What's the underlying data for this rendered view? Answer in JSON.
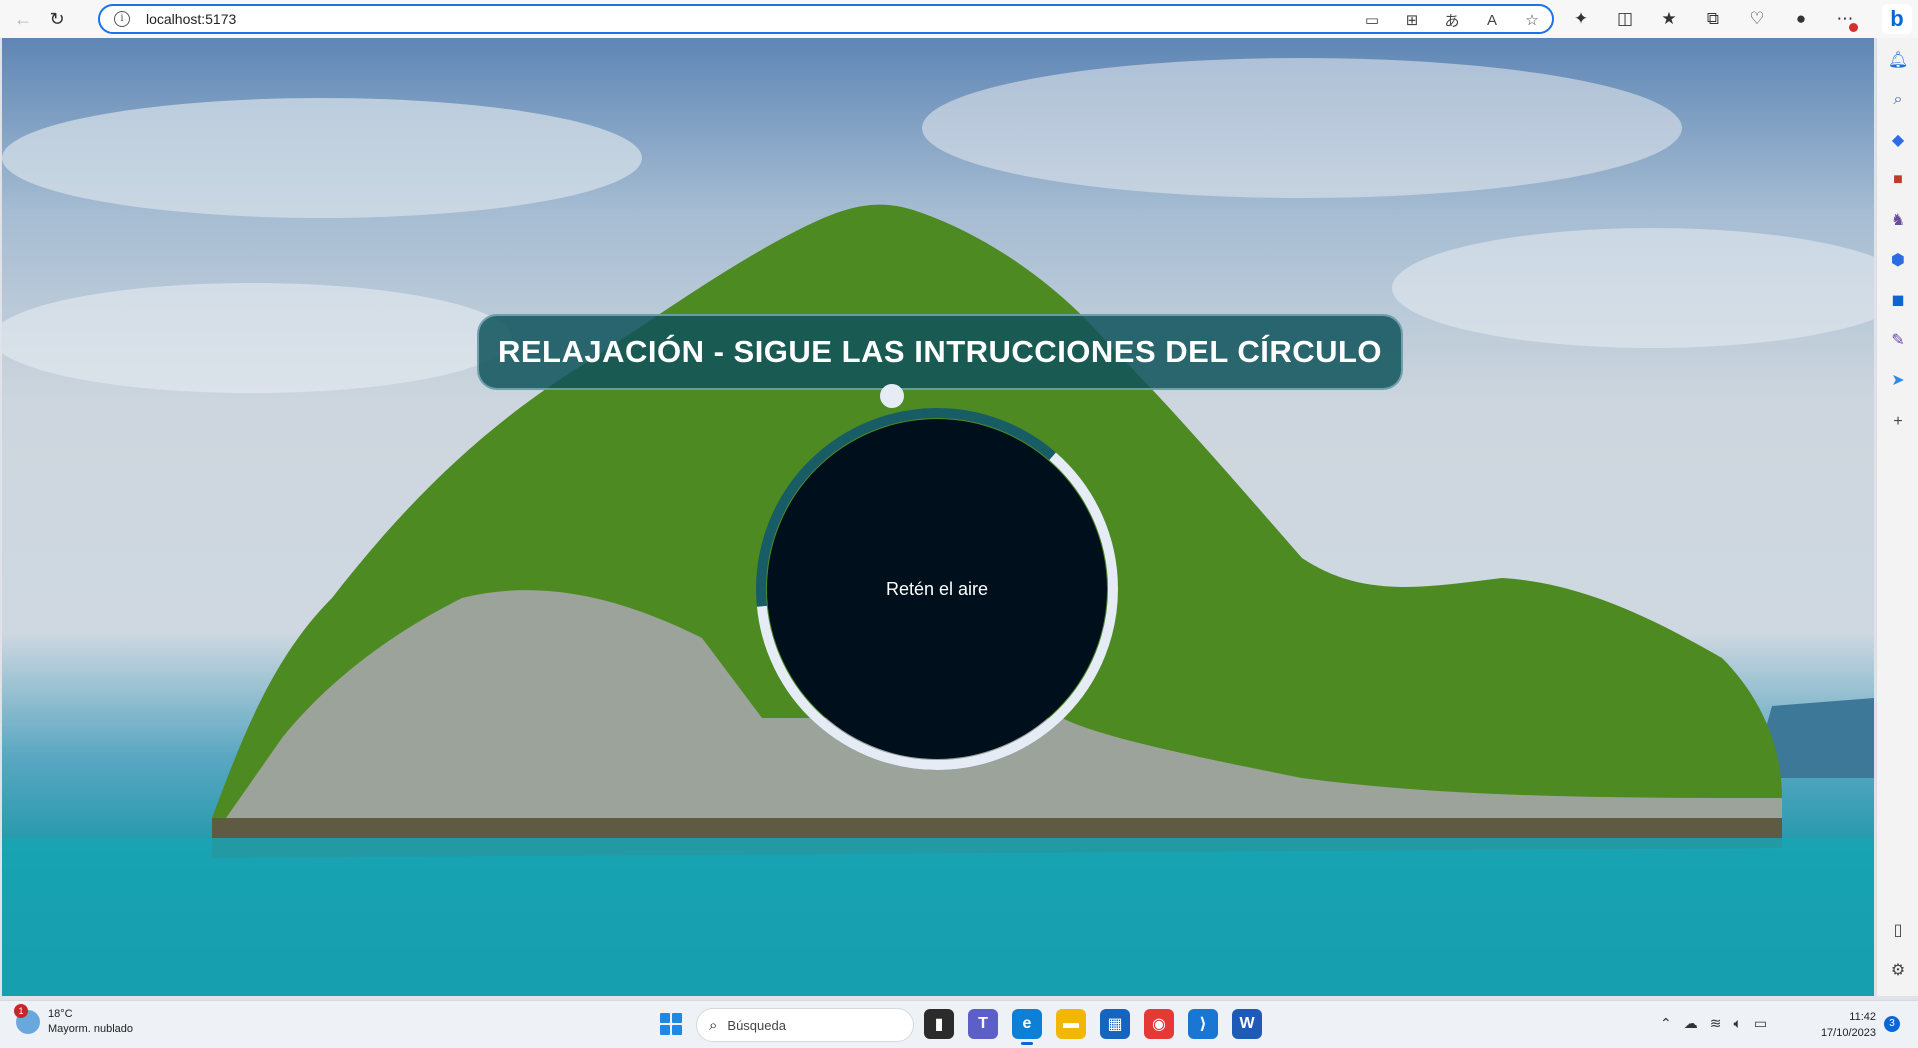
{
  "browser": {
    "url": "localhost:5173",
    "back_icon": "arrow-left",
    "refresh_icon": "refresh",
    "info_icon": "i"
  },
  "page": {
    "title": "RELAJACIÓN - SIGUE LAS INTRUCCIONES DEL CÍRCULO",
    "instruction": "Retén el aire",
    "cycle_progress": 0.62,
    "colors": {
      "title_bg": "#10545c",
      "circle_fill": "#000f1c",
      "ring_track": "#185c66",
      "ring_progress": "#e6ecf5"
    }
  },
  "sidebar": {
    "icons": [
      "bell-icon",
      "search-icon",
      "tag-icon",
      "toolbox-icon",
      "chess-icon",
      "copilot-icon",
      "outlook-icon",
      "edit-icon",
      "send-icon",
      "plus-icon",
      "panel-icon",
      "settings-icon"
    ]
  },
  "taskbar": {
    "weather_temp": "18°C",
    "weather_desc": "Mayorm. nublado",
    "weather_badge": "1",
    "search_placeholder": "Búsqueda",
    "time": "11:42",
    "date": "17/10/2023",
    "notifications": "3"
  }
}
